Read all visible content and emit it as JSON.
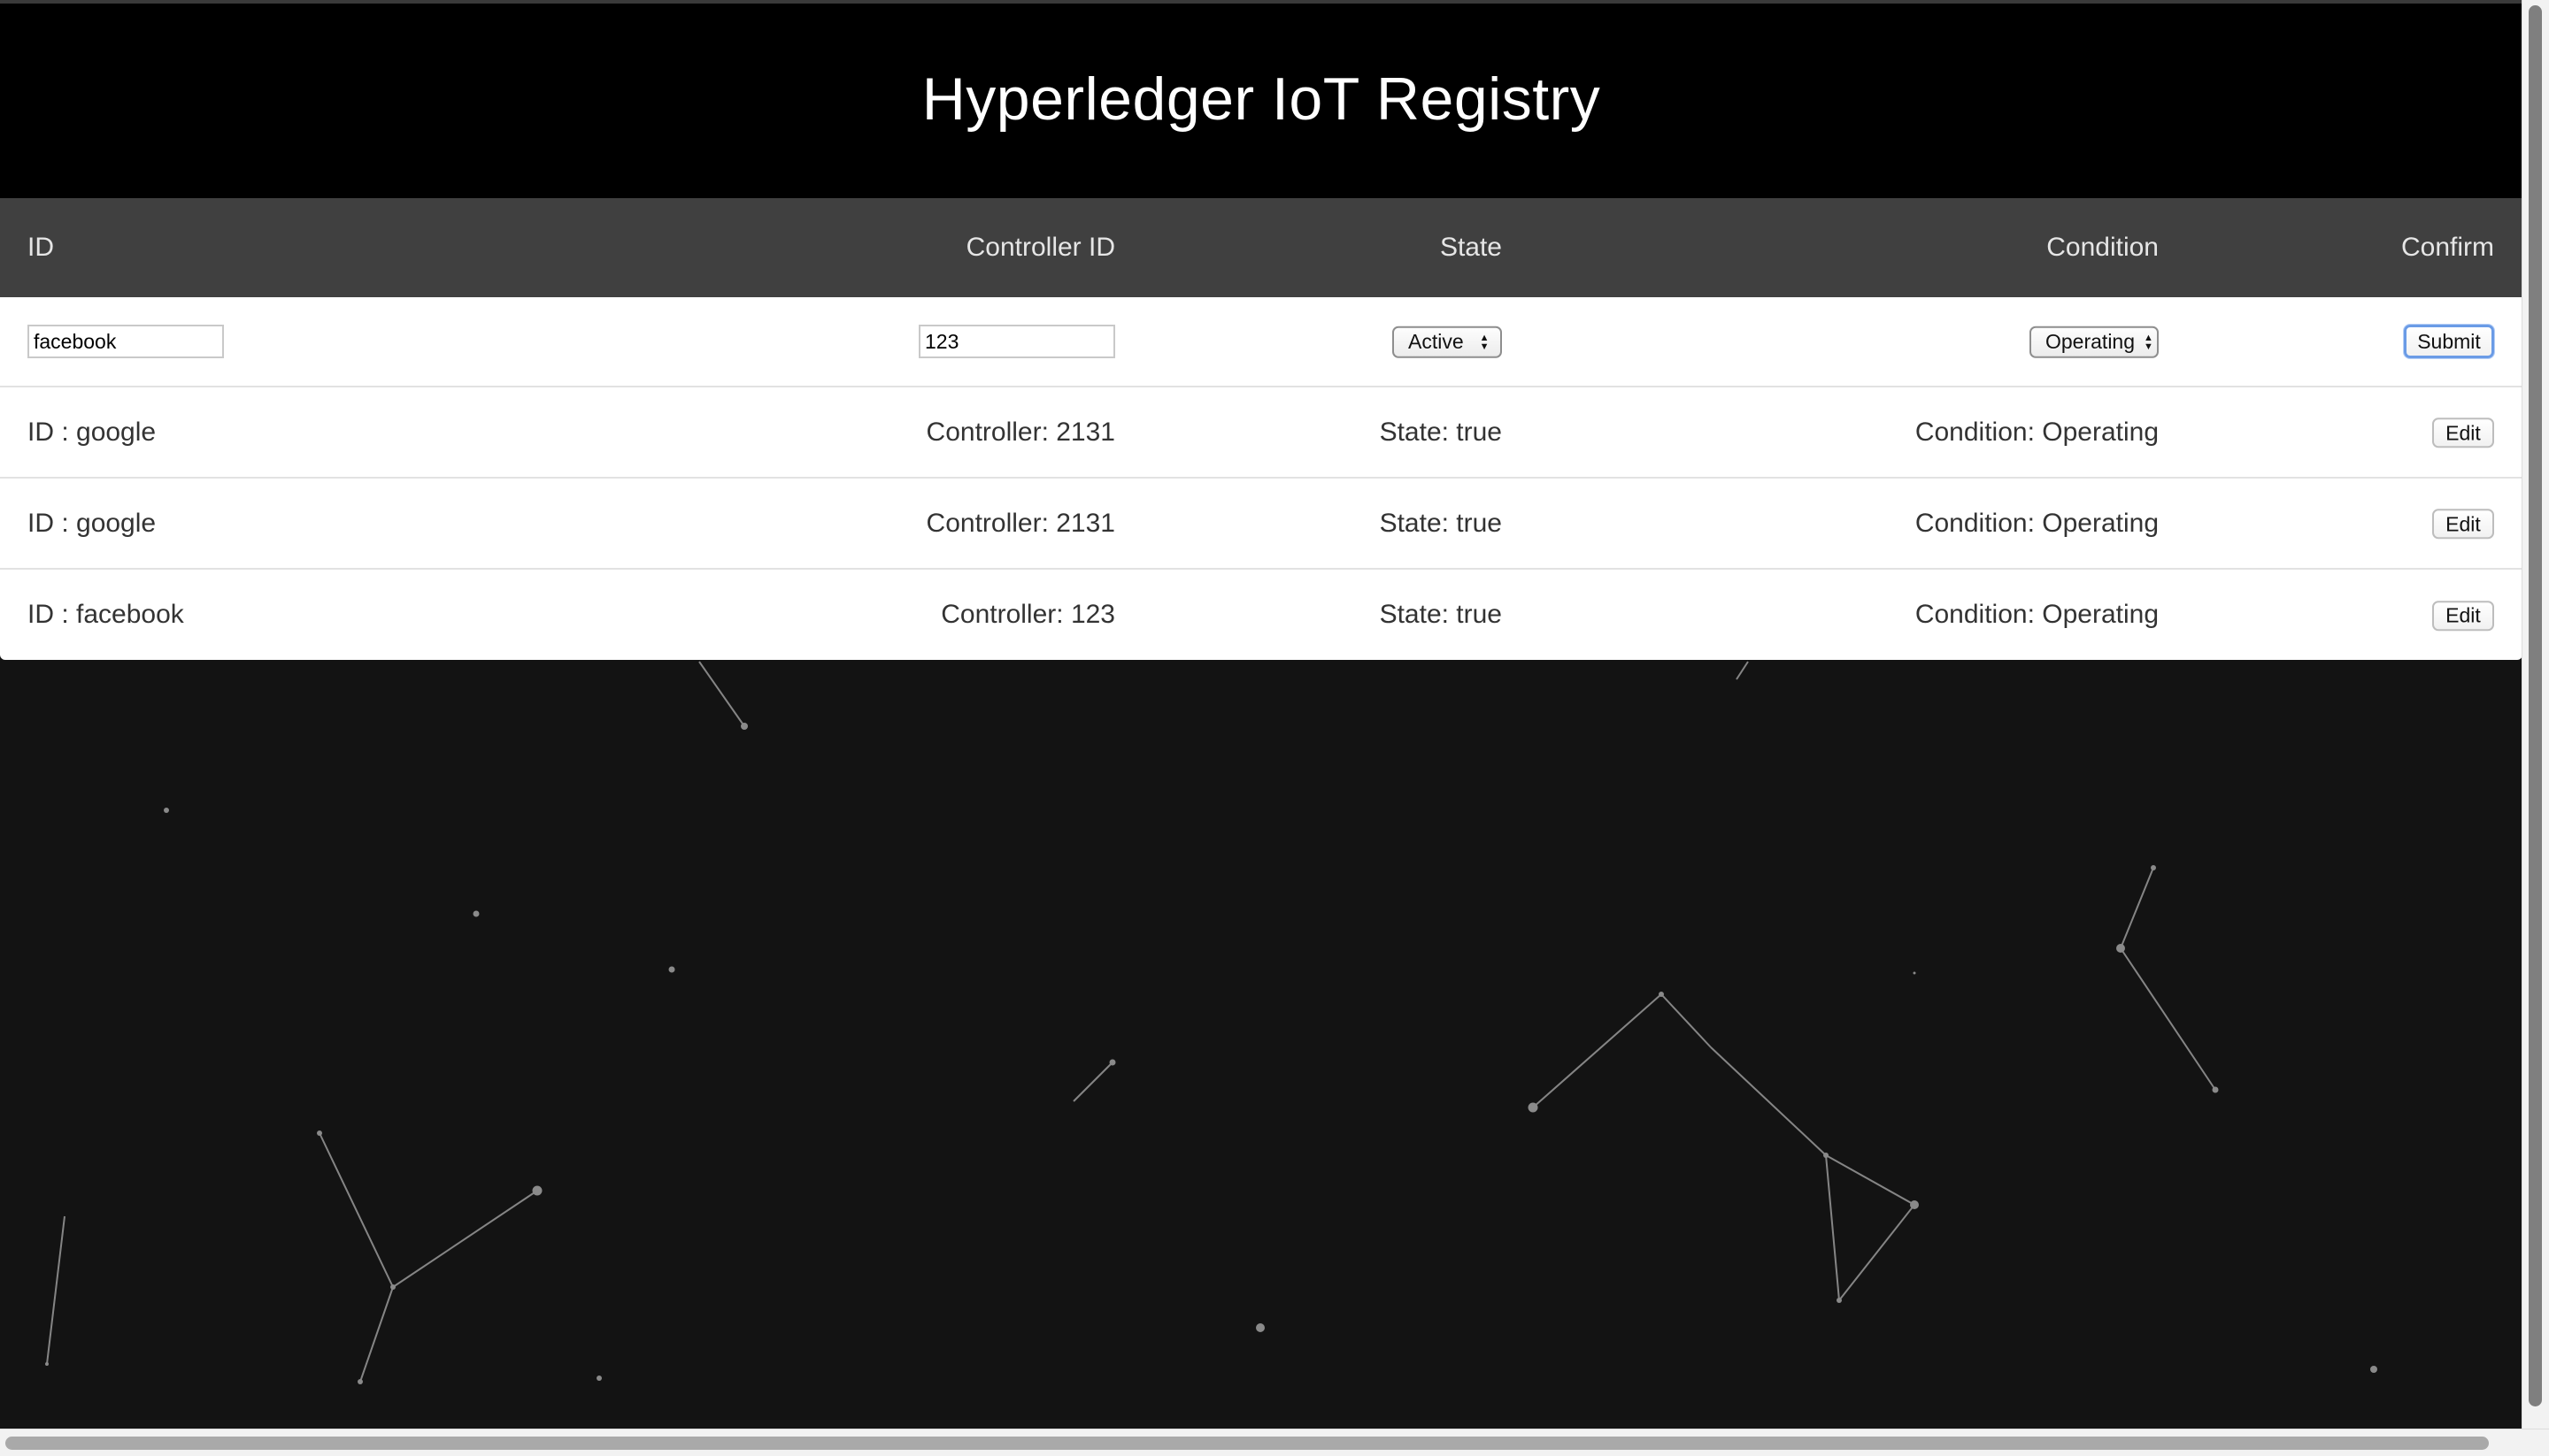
{
  "header": {
    "title": "Hyperledger IoT Registry"
  },
  "table": {
    "columns": {
      "id": "ID",
      "controller": "Controller ID",
      "state": "State",
      "condition": "Condition",
      "confirm": "Confirm"
    },
    "form": {
      "id_value": "facebook",
      "controller_value": "123",
      "state_selected": "Active",
      "condition_selected": "Operating",
      "submit_label": "Submit"
    },
    "rows": [
      {
        "id": "ID : google",
        "controller": "Controller: 2131",
        "state": "State: true",
        "condition": "Condition: Operating",
        "action": "Edit"
      },
      {
        "id": "ID : google",
        "controller": "Controller: 2131",
        "state": "State: true",
        "condition": "Condition: Operating",
        "action": "Edit"
      },
      {
        "id": "ID : facebook",
        "controller": "Controller: 123",
        "state": "State: true",
        "condition": "Condition: Operating",
        "action": "Edit"
      }
    ]
  },
  "colors": {
    "header_bg": "#000000",
    "table_head_bg": "#404040",
    "page_bg": "#131313",
    "submit_focus": "#6a9be6"
  },
  "icons": {
    "select_arrows": "updown-chevron-icon"
  }
}
